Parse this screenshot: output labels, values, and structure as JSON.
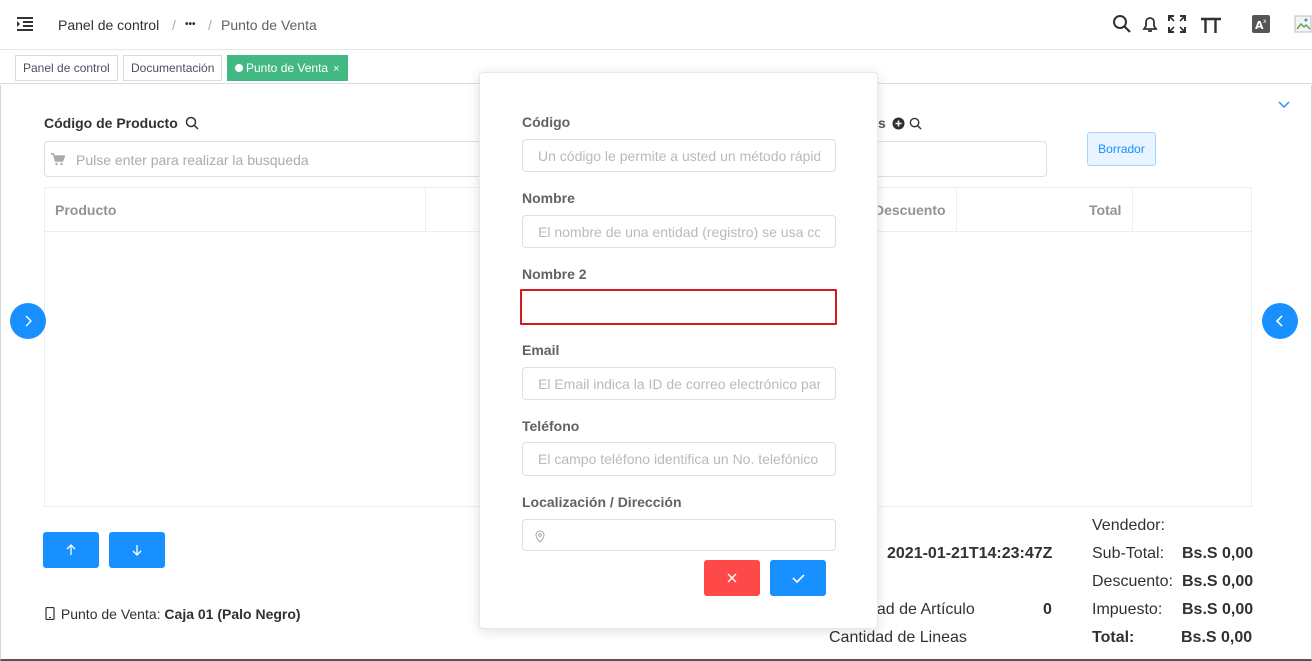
{
  "breadcrumb": {
    "home": "Panel de control",
    "ellipsis": "•••",
    "current": "Punto de Venta"
  },
  "tags": [
    {
      "label": "Panel de control"
    },
    {
      "label": "Documentación"
    },
    {
      "label": "Punto de Venta",
      "close": "×"
    }
  ],
  "product_search": {
    "label": "Código de Producto",
    "placeholder": "Pulse enter para realizar la busqueda"
  },
  "right_header": {
    "label_fragment": "s"
  },
  "draft_button": "Borrador",
  "table": {
    "columns": [
      "Producto",
      "Descuento",
      "Total"
    ]
  },
  "pos_info": {
    "prefix": "Punto de Venta:",
    "value": "Caja 01 (Palo Negro)"
  },
  "order_info": {
    "date": "2021-01-21T14:23:47Z",
    "article_qty_label": "dad de Artículo",
    "article_qty": "0",
    "lines_qty_label": "Cantidad de Lineas"
  },
  "summary": {
    "vendor_label": "Vendedor:",
    "subtotal_label": "Sub-Total:",
    "subtotal": "Bs.S 0,00",
    "discount_label": "Descuento:",
    "discount": "Bs.S 0,00",
    "tax_label": "Impuesto:",
    "tax": "Bs.S 0,00",
    "total_label": "Total:",
    "total": "Bs.S 0,00"
  },
  "modal": {
    "fields": [
      {
        "label": "Código",
        "placeholder": "Un código le permite a usted un método rápido"
      },
      {
        "label": "Nombre",
        "placeholder": "El nombre de una entidad (registro) se usa como"
      },
      {
        "label": "Nombre 2",
        "placeholder": ""
      },
      {
        "label": "Email",
        "placeholder": "El Email indica la ID de correo electrónico para"
      },
      {
        "label": "Teléfono",
        "placeholder": "El campo teléfono identifica un No. telefónico"
      },
      {
        "label": "Localización / Dirección",
        "placeholder": ""
      }
    ]
  },
  "colors": {
    "primary": "#1890ff",
    "danger": "#ff4949",
    "active_tag": "#42b983",
    "error_border": "#d51a1a"
  },
  "icons": [
    "menu-fold-icon",
    "search-icon",
    "bell-icon",
    "fullscreen-icon",
    "font-size-icon",
    "translate-icon",
    "avatar-icon",
    "cart-icon",
    "plus-circle-icon",
    "chevron-down-icon",
    "chevron-right-icon",
    "chevron-left-icon",
    "arrow-up-icon",
    "arrow-down-icon",
    "mobile-icon",
    "location-icon",
    "close-icon",
    "check-icon"
  ]
}
